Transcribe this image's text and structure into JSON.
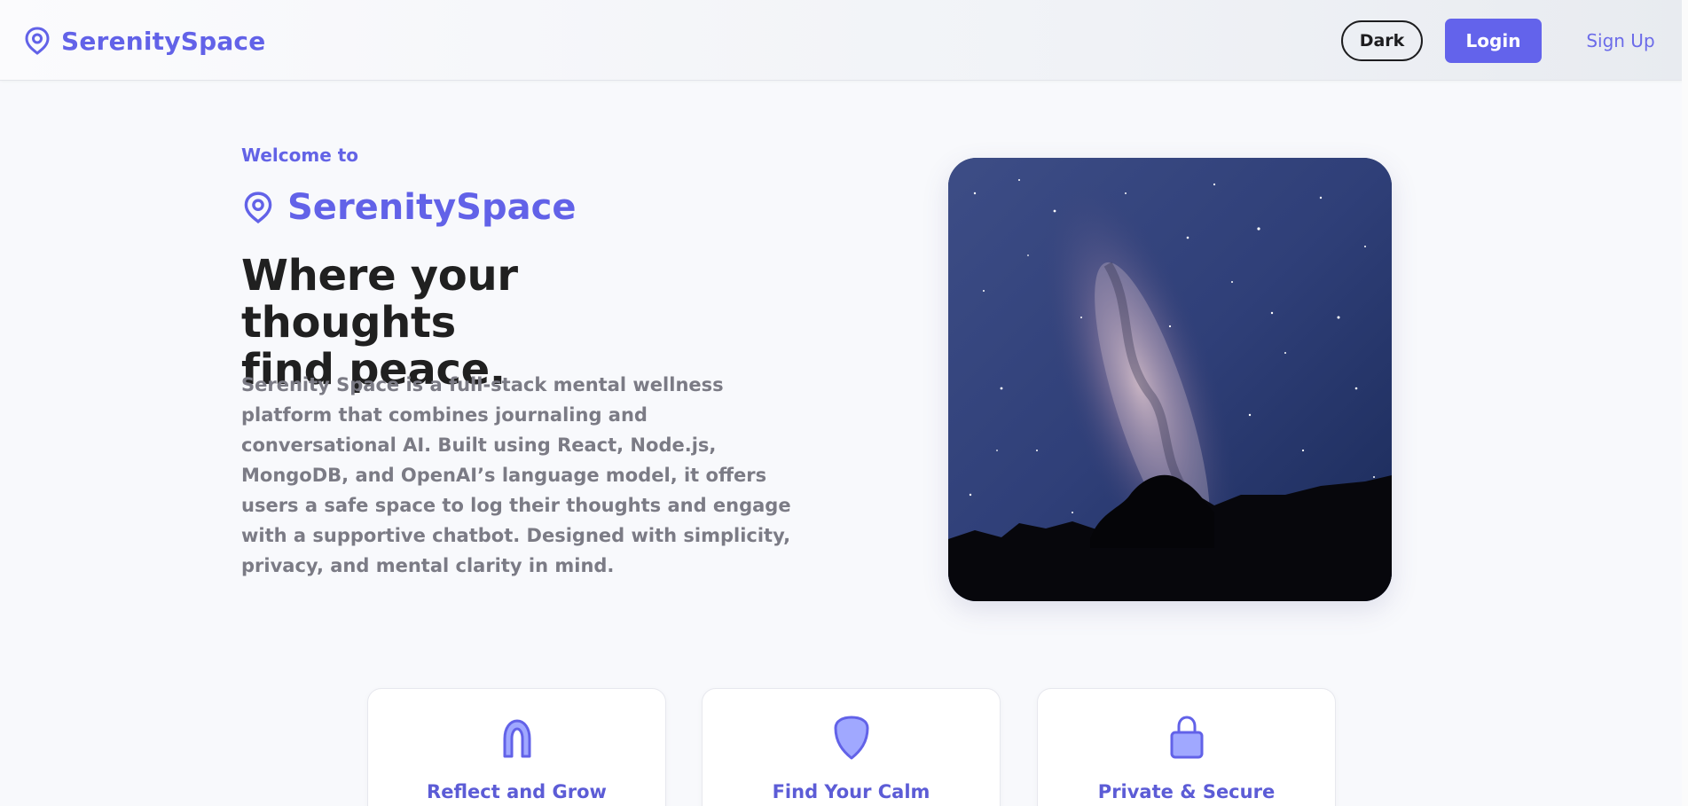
{
  "header": {
    "brand": "SerenitySpace",
    "dark_button": "Dark",
    "login_button": "Login",
    "signup_link": "Sign Up"
  },
  "hero": {
    "welcome": "Welcome to",
    "brand": "SerenitySpace",
    "headline_line1": "Where your thoughts",
    "headline_line2": "find peace.",
    "description": "Serenity Space is a full-stack mental wellness platform that combines journaling and conversational AI. Built using React, Node.js, MongoDB, and OpenAI’s language model, it offers users a safe space to log their thoughts and engage with a supportive chatbot. Designed with simplicity, privacy, and mental clarity in mind."
  },
  "features": [
    {
      "title": "Reflect and Grow",
      "icon": "horseshoe-icon"
    },
    {
      "title": "Find Your Calm",
      "icon": "shield-icon"
    },
    {
      "title": "Private & Secure",
      "icon": "lock-icon"
    }
  ],
  "colors": {
    "accent": "#6363eb",
    "brand_text": "#6262e8",
    "headline": "#202020",
    "body_text": "#7b7b85",
    "background": "#f8f9fc"
  }
}
